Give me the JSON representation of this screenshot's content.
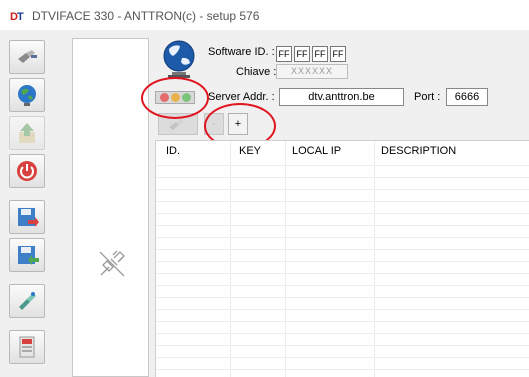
{
  "window": {
    "title": "DTVIFACE 330 - ANTTRON(c) - setup 576"
  },
  "toolbar": {
    "buttons": [
      {
        "icon": "connect-cable-icon",
        "enabled": true
      },
      {
        "icon": "globe-network-icon",
        "enabled": true
      },
      {
        "icon": "upload-house-icon",
        "enabled": false
      },
      {
        "icon": "power-icon",
        "enabled": true
      },
      {
        "icon": "save-export-icon",
        "enabled": true
      },
      {
        "icon": "save-import-icon",
        "enabled": true
      },
      {
        "icon": "antenna-meter-icon",
        "enabled": true
      },
      {
        "icon": "device-panel-icon",
        "enabled": true
      }
    ]
  },
  "form": {
    "software_id_label": "Software ID. :",
    "software_id": [
      "FF",
      "FF",
      "FF",
      "FF"
    ],
    "chiave_label": "Chiave :",
    "chiave_value": "XXXXXX",
    "server_addr_label": "Server Addr. :",
    "server_addr_value": "dtv.anttron.be",
    "port_label": "Port :",
    "port_value": "6666"
  },
  "status_leds": {
    "colors": [
      "#e36b6b",
      "#e8b14a",
      "#7cc47c"
    ]
  },
  "buttons": {
    "minus_label": "-",
    "plus_label": "+"
  },
  "table": {
    "columns": [
      "ID.",
      "KEY",
      "LOCAL IP",
      "DESCRIPTION"
    ],
    "rows": []
  },
  "colors": {
    "annotation": "#e0141e"
  }
}
